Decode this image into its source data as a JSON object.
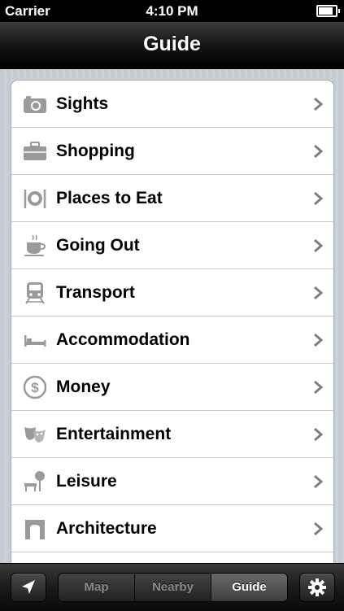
{
  "status_bar": {
    "carrier": "Carrier",
    "time": "4:10 PM"
  },
  "nav": {
    "title": "Guide"
  },
  "list": {
    "items": [
      {
        "label": "Sights",
        "icon": "camera-icon"
      },
      {
        "label": "Shopping",
        "icon": "briefcase-icon"
      },
      {
        "label": "Places to Eat",
        "icon": "plate-cutlery-icon"
      },
      {
        "label": "Going Out",
        "icon": "coffee-cup-icon"
      },
      {
        "label": "Transport",
        "icon": "train-icon"
      },
      {
        "label": "Accommodation",
        "icon": "bed-icon"
      },
      {
        "label": "Money",
        "icon": "dollar-icon"
      },
      {
        "label": "Entertainment",
        "icon": "theater-masks-icon"
      },
      {
        "label": "Leisure",
        "icon": "park-bench-icon"
      },
      {
        "label": "Architecture",
        "icon": "arch-icon"
      }
    ]
  },
  "toolbar": {
    "segments": [
      "Map",
      "Nearby",
      "Guide"
    ],
    "selected_segment": "Guide"
  },
  "colors": {
    "icon_gray": "#9a9a9a",
    "chevron_gray": "#7f7f7f",
    "bar_dark": "#1a1a1a"
  }
}
